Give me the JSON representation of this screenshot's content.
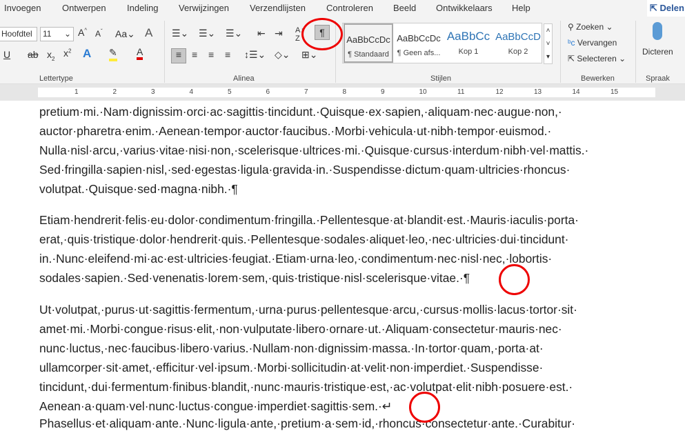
{
  "tabs": [
    "Invoegen",
    "Ontwerpen",
    "Indeling",
    "Verwijzingen",
    "Verzendlijsten",
    "Controleren",
    "Beeld",
    "Ontwikkelaars",
    "Help"
  ],
  "share_label": "Delen",
  "font": {
    "name": "Hoofdtel",
    "size": "11"
  },
  "groups": {
    "lettertype": "Lettertype",
    "alinea": "Alinea",
    "stijlen": "Stijlen",
    "bewerken": "Bewerken",
    "spraak": "Spraak"
  },
  "styles": [
    {
      "sample": "AaBbCcDc",
      "label": "¶ Standaard"
    },
    {
      "sample": "AaBbCcDc",
      "label": "¶ Geen afs..."
    },
    {
      "sample": "AaBbCc",
      "label": "Kop 1"
    },
    {
      "sample": "AaBbCcD",
      "label": "Kop 2"
    }
  ],
  "editing": {
    "find": "Zoeken",
    "replace": "Vervangen",
    "select": "Selecteren"
  },
  "dictate": "Dicteren",
  "pilcrow": "¶",
  "ruler_numbers": [
    "1",
    "2",
    "3",
    "4",
    "5",
    "6",
    "7",
    "8",
    "9",
    "10",
    "11",
    "12",
    "13",
    "14",
    "15"
  ],
  "lines": [
    "pretium·mi.·Nam·dignissim·orci·ac·sagittis·tincidunt.·Quisque·ex·sapien,·aliquam·nec·augue·non,·",
    "auctor·pharetra·enim.·Aenean·tempor·auctor·faucibus.·Morbi·vehicula·ut·nibh·tempor·euismod.·",
    "Nulla·nisl·arcu,·varius·vitae·nisi·non,·scelerisque·ultrices·mi.·Quisque·cursus·interdum·nibh·vel·mattis.·",
    "Sed·fringilla·sapien·nisl,·sed·egestas·ligula·gravida·in.·Suspendisse·dictum·quam·ultricies·rhoncus·",
    "volutpat.·Quisque·sed·magna·nibh.·¶",
    "Etiam·hendrerit·felis·eu·dolor·condimentum·fringilla.·Pellentesque·at·blandit·est.·Mauris·iaculis·porta·",
    "erat,·quis·tristique·dolor·hendrerit·quis.·Pellentesque·sodales·aliquet·leo,·nec·ultricies·dui·tincidunt·",
    "in.·Nunc·eleifend·mi·ac·est·ultricies·feugiat.·Etiam·urna·leo,·condimentum·nec·nisl·nec,·lobortis·",
    "sodales·sapien.·Sed·venenatis·lorem·sem,·quis·tristique·nisl·scelerisque·vitae.·¶",
    "Ut·volutpat,·purus·ut·sagittis·fermentum,·urna·purus·pellentesque·arcu,·cursus·mollis·lacus·tortor·sit·",
    "amet·mi.·Morbi·congue·risus·elit,·non·vulputate·libero·ornare·ut.·Aliquam·consectetur·mauris·nec·",
    "nunc·luctus,·nec·faucibus·libero·varius.·Nullam·non·dignissim·massa.·In·tortor·quam,·porta·at·",
    "ullamcorper·sit·amet,·efficitur·vel·ipsum.·Morbi·sollicitudin·at·velit·non·imperdiet.·Suspendisse·",
    "tincidunt,·dui·fermentum·finibus·blandit,·nunc·mauris·tristique·est,·ac·volutpat·elit·nibh·posuere·est.·",
    "Aenean·a·quam·vel·nunc·luctus·congue·imperdiet·sagittis·sem.·↵",
    "Phasellus·et·aliquam·ante.·Nunc·ligula·ante,·pretium·a·sem·id,·rhoncus·consectetur·ante.·Curabitur·"
  ]
}
